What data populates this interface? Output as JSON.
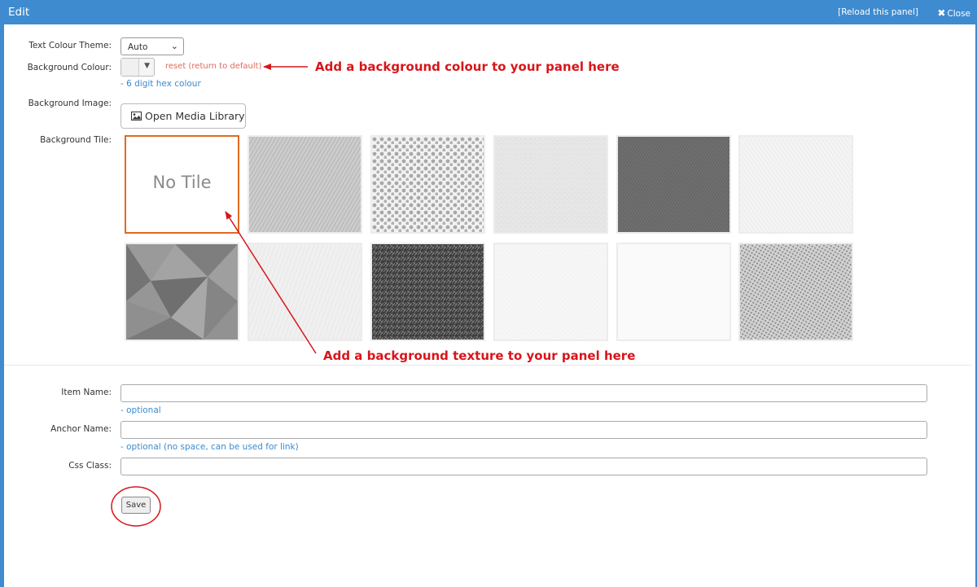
{
  "window": {
    "title": "Edit",
    "reload_label": "[Reload this panel]",
    "close_label": "Close",
    "border_color": "#3e8bd0"
  },
  "form": {
    "text_colour_theme": {
      "label": "Text Colour Theme:",
      "value": "Auto"
    },
    "background_colour": {
      "label": "Background Colour:",
      "reset_label": "reset (return to default)",
      "help": "- 6 digit hex colour"
    },
    "background_image": {
      "label": "Background Image:",
      "button_label": "Open Media Library"
    },
    "background_tile": {
      "label": "Background Tile:",
      "selected": "No Tile",
      "tiles": [
        {
          "name": "no-tile",
          "text": "No Tile"
        },
        {
          "name": "linen",
          "pattern": "diagonal-fabric",
          "tone": "#d0d0d0"
        },
        {
          "name": "dots",
          "pattern": "dots",
          "tone": "#a8a8a8"
        },
        {
          "name": "light-paper",
          "pattern": "speckle",
          "tone": "#e4e4e4"
        },
        {
          "name": "dark-fabric",
          "pattern": "diagonal-fabric",
          "tone": "#6e6e6e"
        },
        {
          "name": "white-diagonal",
          "pattern": "diagonal-light",
          "tone": "#f2f2f2"
        },
        {
          "name": "polygons",
          "pattern": "polygons",
          "tone": "#8a8a8a"
        },
        {
          "name": "white-paper",
          "pattern": "speckle",
          "tone": "#f0f0f0"
        },
        {
          "name": "dark-grass",
          "pattern": "noise-dark",
          "tone": "#4a4a4a"
        },
        {
          "name": "white-texture",
          "pattern": "speckle",
          "tone": "#f7f7f7"
        },
        {
          "name": "plain-white",
          "pattern": "speckle",
          "tone": "#fafafa"
        },
        {
          "name": "grey-mesh",
          "pattern": "mesh",
          "tone": "#9c9c9c"
        }
      ]
    },
    "item_name": {
      "label": "Item Name:",
      "value": "",
      "help": "- optional"
    },
    "anchor_name": {
      "label": "Anchor Name:",
      "value": "",
      "help": "- optional (no space, can be used for link)"
    },
    "css_class": {
      "label": "Css Class:",
      "value": ""
    },
    "save_label": "Save"
  },
  "annotations": {
    "colour_note": "Add a background colour to your panel here",
    "texture_note": "Add a background texture to your panel here",
    "color": "#d8151a"
  },
  "colors": {
    "accent_blue": "#3e8bd0",
    "selected_tile_border": "#e06a1f",
    "reset_link": "#e06a5a"
  }
}
